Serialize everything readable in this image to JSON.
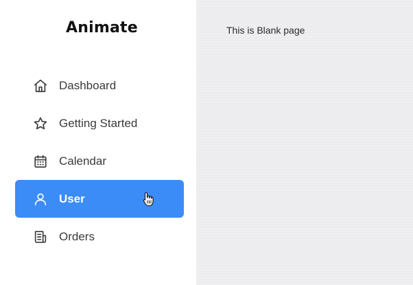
{
  "logo": {
    "text": "Animate"
  },
  "sidebar": {
    "items": [
      {
        "label": "Dashboard",
        "icon": "home-icon"
      },
      {
        "label": "Getting Started",
        "icon": "star-icon"
      },
      {
        "label": "Calendar",
        "icon": "calendar-icon"
      },
      {
        "label": "User",
        "icon": "user-icon",
        "active": true
      },
      {
        "label": "Orders",
        "icon": "orders-icon"
      }
    ],
    "active_color": "#3c8cf7"
  },
  "main": {
    "text": "This is Blank page"
  }
}
